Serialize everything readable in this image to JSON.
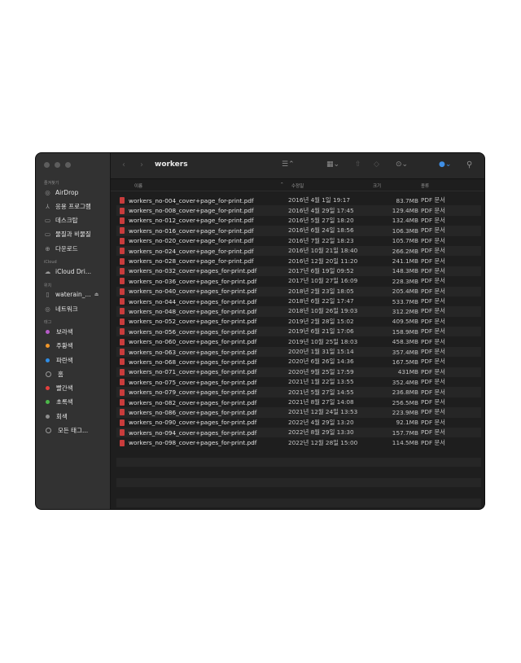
{
  "window": {
    "title": "workers"
  },
  "sidebar": {
    "favorites_label": "즐겨찾기",
    "favorites": [
      {
        "label": "AirDrop",
        "icon": "airdrop-icon",
        "glyph": "◎"
      },
      {
        "label": "응용 프로그램",
        "icon": "applications-icon",
        "glyph": "⅄"
      },
      {
        "label": "데스크탑",
        "icon": "desktop-icon",
        "glyph": "▭"
      },
      {
        "label": "물질과 비물질",
        "icon": "folder-icon",
        "glyph": "▭"
      },
      {
        "label": "다운로드",
        "icon": "download-icon",
        "glyph": "⊕"
      }
    ],
    "icloud_label": "iCloud",
    "icloud": [
      {
        "label": "iCloud Dri...",
        "icon": "cloud-icon",
        "glyph": "☁"
      }
    ],
    "locations_label": "위치",
    "locations": [
      {
        "label": "waterain_...",
        "icon": "drive-icon",
        "glyph": "▯",
        "eject": "⏏"
      },
      {
        "label": "네트워크",
        "icon": "network-icon",
        "glyph": "◎"
      }
    ],
    "tags_label": "태그",
    "tags": [
      {
        "label": "보라색",
        "color": "#b65bc8"
      },
      {
        "label": "주황색",
        "color": "#f0962a"
      },
      {
        "label": "파란색",
        "color": "#2f8de5"
      },
      {
        "label": "홈",
        "color": "#1e1e1e"
      },
      {
        "label": "빨간색",
        "color": "#e4403d"
      },
      {
        "label": "초록색",
        "color": "#4cb84a"
      },
      {
        "label": "회색",
        "color": "#8e8e8e"
      },
      {
        "label": "모든 태그...",
        "color": "none"
      }
    ]
  },
  "columns": {
    "name": "이름",
    "date": "수정일",
    "size": "크기",
    "kind": "종류"
  },
  "files": [
    {
      "name": "workers_no-004_cover+page_for-print.pdf",
      "date": "2016년 4월 1일 19:17",
      "size": "83.7MB",
      "kind": "PDF 문서"
    },
    {
      "name": "workers_no-008_cover+page_for-print.pdf",
      "date": "2016년 4월 29일 17:45",
      "size": "129.4MB",
      "kind": "PDF 문서"
    },
    {
      "name": "workers_no-012_cover+page_for-print.pdf",
      "date": "2016년 5월 27일 18:20",
      "size": "132.4MB",
      "kind": "PDF 문서"
    },
    {
      "name": "workers_no-016_cover+page_for-print.pdf",
      "date": "2016년 6월 24일 18:56",
      "size": "106.3MB",
      "kind": "PDF 문서"
    },
    {
      "name": "workers_no-020_cover+page_for-print.pdf",
      "date": "2016년 7월 22일 18:23",
      "size": "105.7MB",
      "kind": "PDF 문서"
    },
    {
      "name": "workers_no-024_cover+page_for-print.pdf",
      "date": "2016년 10월 21일 18:40",
      "size": "266.2MB",
      "kind": "PDF 문서"
    },
    {
      "name": "workers_no-028_cover+page_for-print.pdf",
      "date": "2016년 12월 20일 11:20",
      "size": "241.1MB",
      "kind": "PDF 문서"
    },
    {
      "name": "workers_no-032_cover+pages_for-print.pdf",
      "date": "2017년 6월 19일 09:52",
      "size": "148.3MB",
      "kind": "PDF 문서"
    },
    {
      "name": "workers_no-036_cover+pages_for-print.pdf",
      "date": "2017년 10월 27일 16:09",
      "size": "228.3MB",
      "kind": "PDF 문서"
    },
    {
      "name": "workers_no-040_cover+pages_for-print.pdf",
      "date": "2018년 2월 23일 18:05",
      "size": "205.4MB",
      "kind": "PDF 문서"
    },
    {
      "name": "workers_no-044_cover+pages_for-print.pdf",
      "date": "2018년 6월 22일 17:47",
      "size": "533.7MB",
      "kind": "PDF 문서"
    },
    {
      "name": "workers_no-048_cover+pages_for-print.pdf",
      "date": "2018년 10월 26일 19:03",
      "size": "312.2MB",
      "kind": "PDF 문서"
    },
    {
      "name": "workers_no-052_cover+pages_for-print.pdf",
      "date": "2019년 2월 28일 15:02",
      "size": "409.5MB",
      "kind": "PDF 문서"
    },
    {
      "name": "workers_no-056_cover+pages_for-print.pdf",
      "date": "2019년 6월 21일 17:06",
      "size": "158.9MB",
      "kind": "PDF 문서"
    },
    {
      "name": "workers_no-060_cover+pages_for-print.pdf",
      "date": "2019년 10월 25일 18:03",
      "size": "458.3MB",
      "kind": "PDF 문서"
    },
    {
      "name": "workers_no-063_cover+pages_for-print.pdf",
      "date": "2020년 1월 31일 15:14",
      "size": "357.4MB",
      "kind": "PDF 문서"
    },
    {
      "name": "workers_no-068_cover+pages_for-print.pdf",
      "date": "2020년 6월 26일 14:36",
      "size": "167.5MB",
      "kind": "PDF 문서"
    },
    {
      "name": "workers_no-071_cover+pages_for-print.pdf",
      "date": "2020년 9월 25일 17:59",
      "size": "431MB",
      "kind": "PDF 문서"
    },
    {
      "name": "workers_no-075_cover+pages_for-print.pdf",
      "date": "2021년 1월 22일 13:55",
      "size": "352.4MB",
      "kind": "PDF 문서"
    },
    {
      "name": "workers_no-079_cover+pages_for-print.pdf",
      "date": "2021년 5월 27일 14:55",
      "size": "236.8MB",
      "kind": "PDF 문서"
    },
    {
      "name": "workers_no-082_cover+pages_for-print.pdf",
      "date": "2021년 8월 27일 14:08",
      "size": "256.5MB",
      "kind": "PDF 문서"
    },
    {
      "name": "workers_no-086_cover+pages_for-print.pdf",
      "date": "2021년 12월 24일 13:53",
      "size": "223.9MB",
      "kind": "PDF 문서"
    },
    {
      "name": "workers_no-090_cover+pages_for-print.pdf",
      "date": "2022년 4월 29일 13:20",
      "size": "92.1MB",
      "kind": "PDF 문서"
    },
    {
      "name": "workers_no-094_cover+pages_for-print.pdf",
      "date": "2022년 8월 29일 13:30",
      "size": "157.7MB",
      "kind": "PDF 문서"
    },
    {
      "name": "workers_no-098_cover+pages_for-print.pdf",
      "date": "2022년 12월 28일 15:00",
      "size": "114.5MB",
      "kind": "PDF 문서"
    }
  ]
}
